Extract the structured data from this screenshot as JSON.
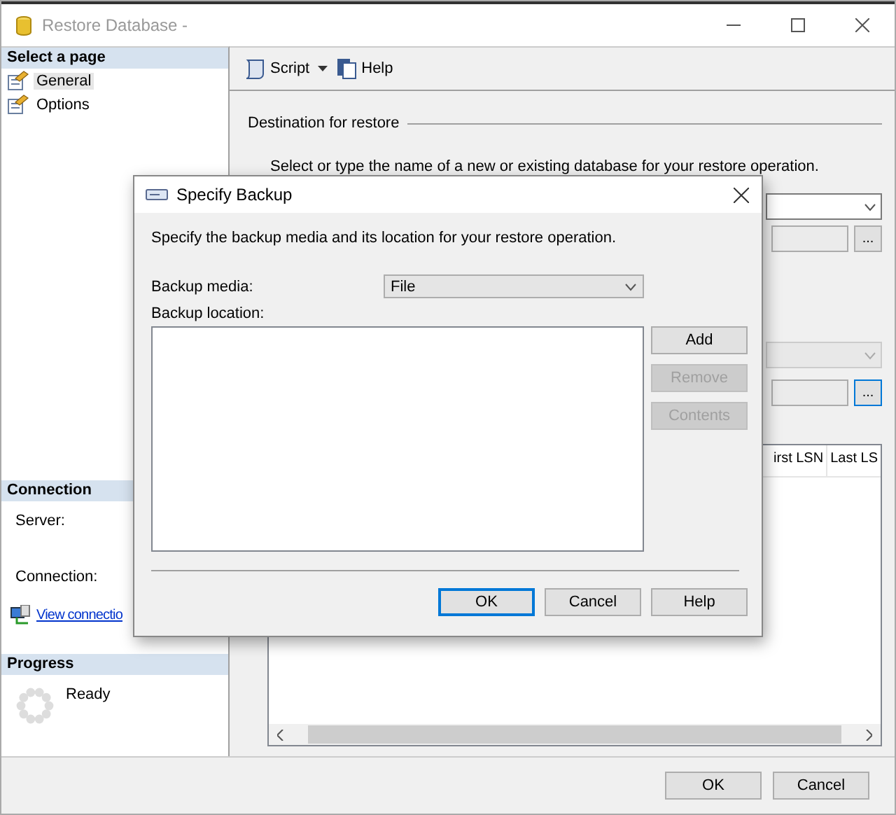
{
  "window": {
    "title": "Restore Database -"
  },
  "sidebar": {
    "select_page_header": "Select a page",
    "pages": [
      {
        "label": "General",
        "selected": true
      },
      {
        "label": "Options",
        "selected": false
      }
    ],
    "connection_header": "Connection",
    "connection_fields": [
      "Server:",
      "Connection:"
    ],
    "connection_link": "View connectio",
    "progress_header": "Progress",
    "progress_status": "Ready"
  },
  "toolbar": {
    "script": "Script",
    "help": "Help"
  },
  "content": {
    "destination_heading": "Destination for restore",
    "description": "Select or type the name of a new or existing database for your restore operation.",
    "controls": [
      {
        "kind": "dropdown",
        "disabled": false
      },
      {
        "kind": "field",
        "button": "...",
        "focused": false
      },
      {
        "kind": "dropdown",
        "disabled": true
      },
      {
        "kind": "field",
        "button": "...",
        "focused": true
      }
    ],
    "grid": {
      "columns": [
        "irst LSN",
        "Last LS"
      ]
    }
  },
  "footer_buttons": [
    {
      "label": "OK"
    },
    {
      "label": "Cancel"
    }
  ],
  "dialog": {
    "title": "Specify Backup",
    "description": "Specify the backup media and its location for your restore operation.",
    "media_label": "Backup media:",
    "media_value": "File",
    "location_label": "Backup location:",
    "side_buttons": [
      {
        "label": "Add",
        "disabled": false
      },
      {
        "label": "Remove",
        "disabled": true
      },
      {
        "label": "Contents",
        "disabled": true
      }
    ],
    "buttons": [
      {
        "label": "OK",
        "default": true
      },
      {
        "label": "Cancel",
        "default": false
      },
      {
        "label": "Help",
        "default": false
      }
    ]
  }
}
